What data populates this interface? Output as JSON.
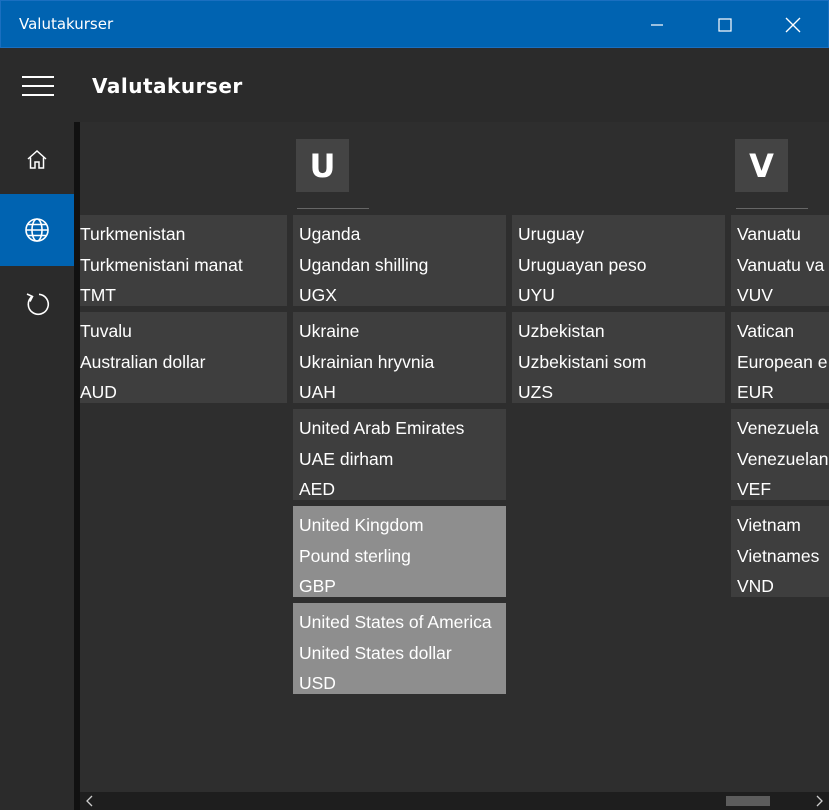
{
  "window": {
    "title": "Valutakurser"
  },
  "header": {
    "title": "Valutakurser"
  },
  "sidebar": {
    "items": [
      {
        "icon": "home-icon"
      },
      {
        "icon": "globe-icon",
        "selected": true
      },
      {
        "icon": "refresh-icon"
      }
    ]
  },
  "groups": {
    "u": {
      "letter": "U"
    },
    "v": {
      "letter": "V"
    }
  },
  "tiles": {
    "turkmenistan": {
      "country": "Turkmenistan",
      "currency": "Turkmenistani manat",
      "code": "TMT"
    },
    "tuvalu": {
      "country": "Tuvalu",
      "currency": "Australian dollar",
      "code": "AUD"
    },
    "uganda": {
      "country": "Uganda",
      "currency": "Ugandan shilling",
      "code": "UGX"
    },
    "ukraine": {
      "country": "Ukraine",
      "currency": "Ukrainian hryvnia",
      "code": "UAH"
    },
    "uae": {
      "country": "United Arab Emirates",
      "currency": "UAE dirham",
      "code": "AED"
    },
    "uk": {
      "country": "United Kingdom",
      "currency": "Pound sterling",
      "code": "GBP",
      "selected": true
    },
    "usa": {
      "country": "United States of America",
      "currency": "United States dollar",
      "code": "USD",
      "selected": true
    },
    "uruguay": {
      "country": "Uruguay",
      "currency": "Uruguayan peso",
      "code": "UYU"
    },
    "uzbekistan": {
      "country": "Uzbekistan",
      "currency": "Uzbekistani som",
      "code": "UZS"
    },
    "vanuatu": {
      "country": "Vanuatu",
      "currency": "Vanuatu va",
      "code": "VUV"
    },
    "vatican": {
      "country": "Vatican",
      "currency": "European e",
      "code": "EUR"
    },
    "venezuela": {
      "country": "Venezuela",
      "currency": "Venezuelan",
      "code": "VEF"
    },
    "vietnam": {
      "country": "Vietnam",
      "currency": "Vietnames",
      "code": "VND"
    }
  },
  "colors": {
    "accent": "#0063b1",
    "tile": "#3e3e3e",
    "tile_selected": "#8e8e8e",
    "background": "#2b2b2b"
  }
}
